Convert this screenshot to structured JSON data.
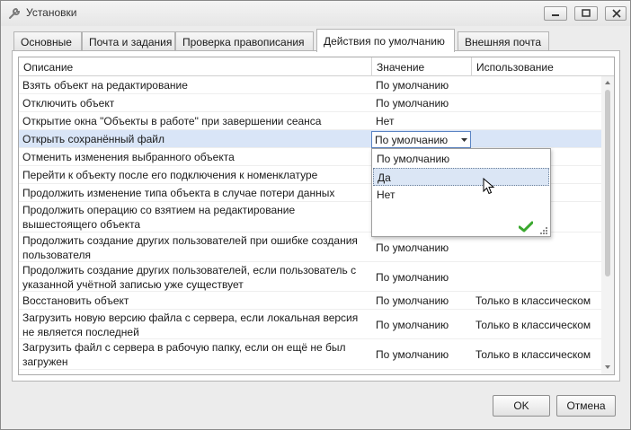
{
  "window": {
    "title": "Установки",
    "controls": {
      "minimize": "minimize-icon",
      "maximize": "maximize-icon",
      "close": "close-icon"
    }
  },
  "tabs": [
    {
      "label": "Основные"
    },
    {
      "label": "Почта и задания"
    },
    {
      "label": "Проверка правописания"
    },
    {
      "label": "Действия по умолчанию",
      "active": true
    },
    {
      "label": "Внешняя почта"
    }
  ],
  "grid": {
    "columns": [
      "Описание",
      "Значение",
      "Использование"
    ],
    "rows": [
      {
        "desc": "Взять объект на редактирование",
        "value": "По умолчанию",
        "usage": ""
      },
      {
        "desc": "Отключить объект",
        "value": "По умолчанию",
        "usage": ""
      },
      {
        "desc": "Открытие окна \"Объекты в работе\" при завершении сеанса",
        "value": "Нет",
        "usage": ""
      },
      {
        "desc": "Открыть сохранённый файл",
        "value": "",
        "usage": ""
      },
      {
        "desc": "Отменить изменения выбранного объекта",
        "value": "",
        "usage": ""
      },
      {
        "desc": "Перейти к объекту после его подключения к номенклатуре",
        "value": "",
        "usage": ""
      },
      {
        "desc": "Продолжить изменение типа объекта в случае потери данных",
        "value": "",
        "usage": ""
      },
      {
        "desc": "Продолжить операцию со взятием на редактирование вышестоящего объекта",
        "value": "",
        "usage": ""
      },
      {
        "desc": "Продолжить создание других пользователей при ошибке создания пользователя",
        "value": "По умолчанию",
        "usage": ""
      },
      {
        "desc": "Продолжить создание других пользователей, если пользователь с указанной учётной записью уже существует",
        "value": "По умолчанию",
        "usage": ""
      },
      {
        "desc": "Восстановить объект",
        "value": "По умолчанию",
        "usage": "Только в классическом"
      },
      {
        "desc": "Загрузить новую версию файла с сервера, если локальная версия не является последней",
        "value": "По умолчанию",
        "usage": "Только в классическом"
      },
      {
        "desc": "Загрузить файл с сервера в рабочую папку, если он ещё не был загружен",
        "value": "По умолчанию",
        "usage": "Только в классическом"
      }
    ]
  },
  "editor": {
    "current_value": "По умолчанию",
    "options": [
      "По умолчанию",
      "Да",
      "Нет"
    ],
    "hovered_option": "Да"
  },
  "buttons": {
    "ok": "OK",
    "cancel": "Отмена"
  },
  "colors": {
    "selection": "#d9e5f7",
    "ok_check": "#3aa82e"
  }
}
